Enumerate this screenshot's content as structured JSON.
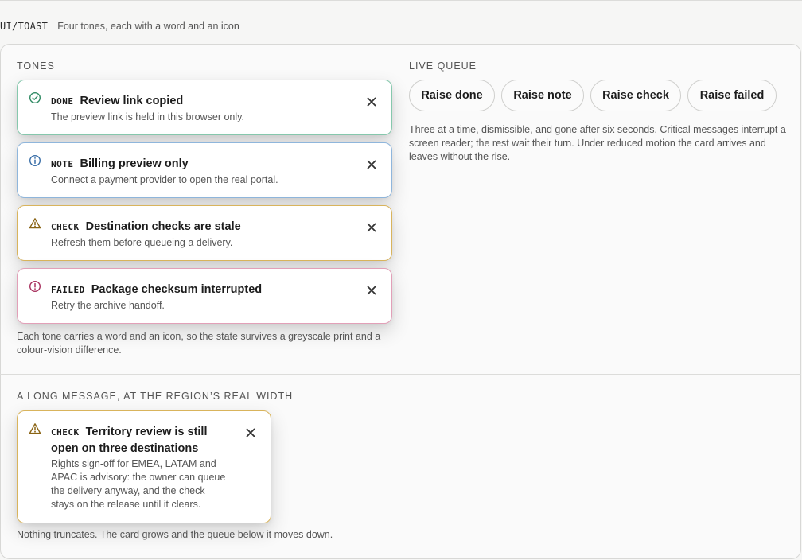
{
  "header": {
    "code": "UI/TOAST",
    "description": "Four tones, each with a word and an icon"
  },
  "tones_section": {
    "eyebrow": "TONES",
    "toasts": [
      {
        "tag": "DONE",
        "title": "Review link copied",
        "body": "The preview link is held in this browser only.",
        "icon": "check-circle-icon",
        "color": "#2f8a63"
      },
      {
        "tag": "NOTE",
        "title": "Billing preview only",
        "body": "Connect a payment provider to open the real portal.",
        "icon": "info-circle-icon",
        "color": "#3a6fa8"
      },
      {
        "tag": "CHECK",
        "title": "Destination checks are stale",
        "body": "Refresh them before queueing a delivery.",
        "icon": "warning-triangle-icon",
        "color": "#8a6414"
      },
      {
        "tag": "FAILED",
        "title": "Package checksum interrupted",
        "body": "Retry the archive handoff.",
        "icon": "alert-circle-icon",
        "color": "#a8325f"
      }
    ],
    "footnote": "Each tone carries a word and an icon, so the state survives a greyscale print and a colour-vision difference."
  },
  "live_queue": {
    "eyebrow": "LIVE QUEUE",
    "buttons": [
      "Raise done",
      "Raise note",
      "Raise check",
      "Raise failed"
    ],
    "description": "Three at a time, dismissible, and gone after six seconds. Critical messages interrupt a screen reader; the rest wait their turn. Under reduced motion the card arrives and leaves without the rise."
  },
  "long_message": {
    "eyebrow": "A LONG MESSAGE, AT THE REGION’S REAL WIDTH",
    "toast": {
      "tag": "CHECK",
      "title_line1": "Territory review is still",
      "title_line2": "open on three destinations",
      "body_lines": [
        "Rights sign-off for EMEA, LATAM and",
        "APAC is advisory: the owner can queue",
        "the delivery anyway, and the check",
        "stays on the release until it clears."
      ],
      "icon": "warning-triangle-icon",
      "color": "#8a6414"
    },
    "footnote": "Nothing truncates. The card grows and the queue below it moves down."
  },
  "colors": {
    "done_border": "#86c8ad",
    "note_border": "#8fb6dc",
    "check_border": "#d9b45c",
    "failed_border": "#e2a0b8"
  }
}
